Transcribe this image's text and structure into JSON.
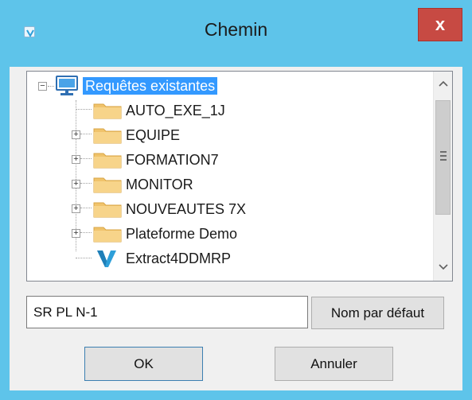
{
  "window": {
    "title": "Chemin",
    "close_label": "x"
  },
  "tree": {
    "root": {
      "label": "Requêtes existantes",
      "icon": "computer-icon",
      "expanded": true,
      "selected": true
    },
    "children": [
      {
        "label": "AUTO_EXE_1J",
        "icon": "folder-icon",
        "expandable": false
      },
      {
        "label": "EQUIPE",
        "icon": "folder-icon",
        "expandable": true
      },
      {
        "label": "FORMATION7",
        "icon": "folder-icon",
        "expandable": true
      },
      {
        "label": "MONITOR",
        "icon": "folder-icon",
        "expandable": true
      },
      {
        "label": "NOUVEAUTES 7X",
        "icon": "folder-icon",
        "expandable": true
      },
      {
        "label": "Plateforme Demo",
        "icon": "folder-icon",
        "expandable": true
      },
      {
        "label": "Extract4DDMRP",
        "icon": "v-logo-icon",
        "expandable": false
      }
    ]
  },
  "name_field": {
    "value": "SR PL N-1"
  },
  "buttons": {
    "default_name": "Nom par défaut",
    "ok": "OK",
    "cancel": "Annuler"
  },
  "colors": {
    "titlebar": "#5ec4ea",
    "close": "#c74a43",
    "selection": "#3399ff",
    "folder": "#f0c36b",
    "logo": "#2d9fd9"
  }
}
